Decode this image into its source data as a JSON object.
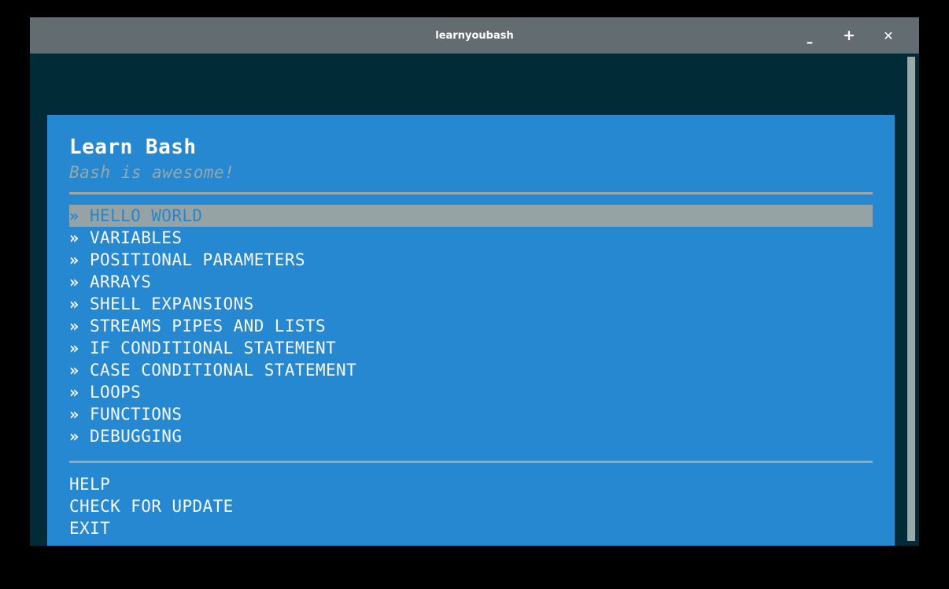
{
  "window": {
    "title": "learnyoubash",
    "controls": {
      "minimize": "–",
      "maximize": "+",
      "close": "✕"
    }
  },
  "app": {
    "title": "Learn Bash",
    "subtitle": "Bash is awesome!",
    "bullet": "»",
    "menu_items": [
      {
        "label": "HELLO WORLD",
        "selected": true
      },
      {
        "label": "VARIABLES",
        "selected": false
      },
      {
        "label": "POSITIONAL PARAMETERS",
        "selected": false
      },
      {
        "label": "ARRAYS",
        "selected": false
      },
      {
        "label": "SHELL EXPANSIONS",
        "selected": false
      },
      {
        "label": "STREAMS PIPES AND LISTS",
        "selected": false
      },
      {
        "label": "IF CONDITIONAL STATEMENT",
        "selected": false
      },
      {
        "label": "CASE CONDITIONAL STATEMENT",
        "selected": false
      },
      {
        "label": "LOOPS",
        "selected": false
      },
      {
        "label": "FUNCTIONS",
        "selected": false
      },
      {
        "label": "DEBUGGING",
        "selected": false
      }
    ],
    "footer_items": [
      {
        "label": "HELP"
      },
      {
        "label": "CHECK FOR UPDATE"
      },
      {
        "label": "EXIT"
      }
    ]
  },
  "colors": {
    "panel_blue": "#2688d0",
    "window_bg": "#022b38",
    "titlebar_gray": "#636c70",
    "highlight_gray": "#96a3a4",
    "divider_gray": "#9aa8a9",
    "text_white": "#f7f7f2"
  }
}
